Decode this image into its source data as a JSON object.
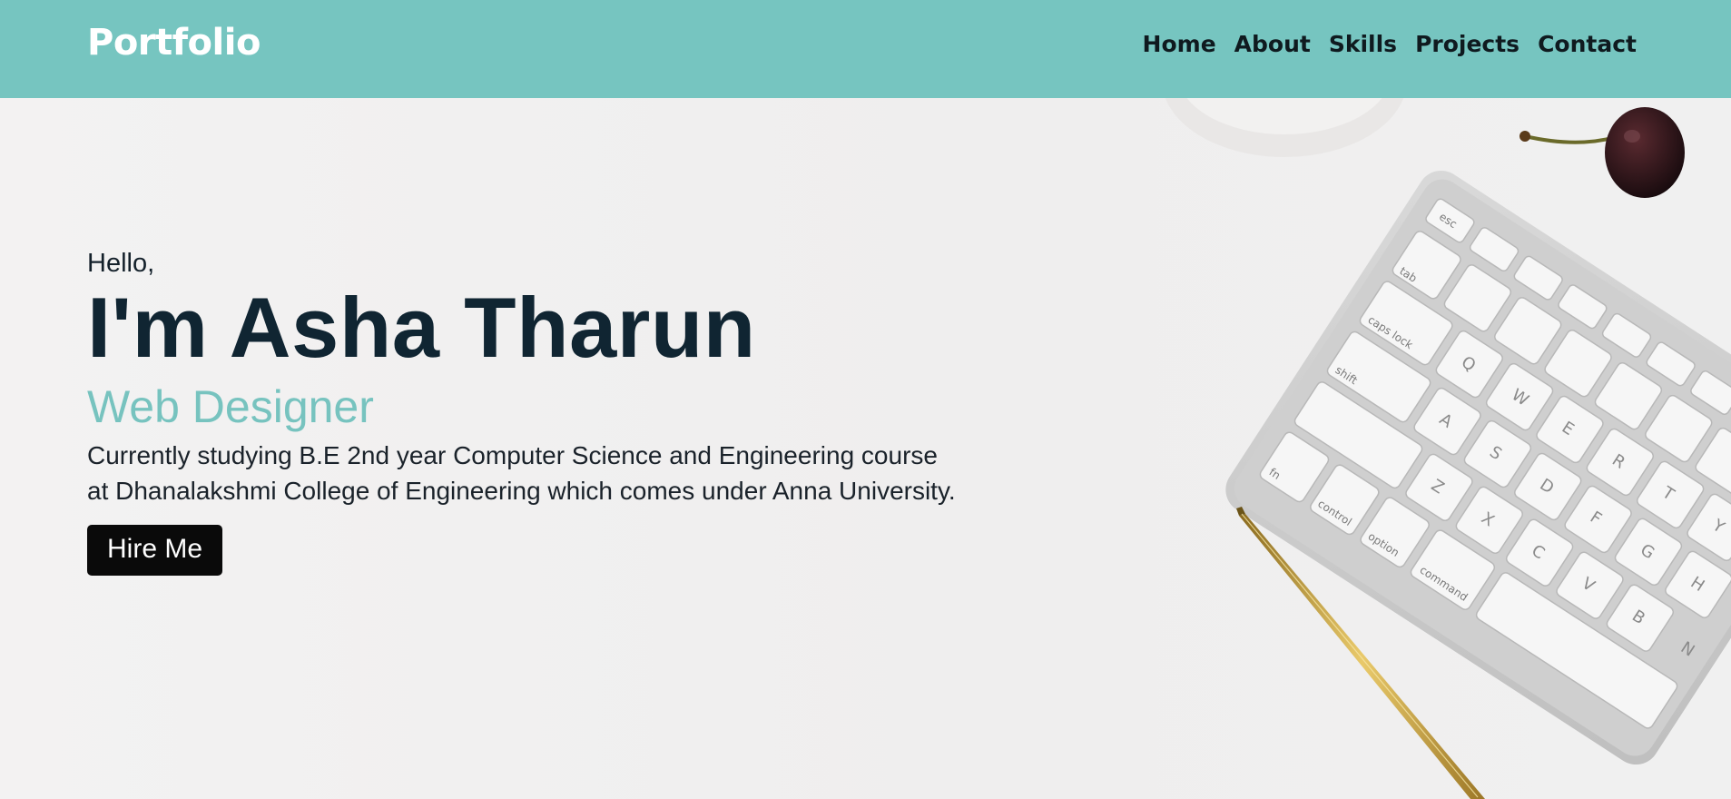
{
  "header": {
    "logo": "Portfolio",
    "nav": [
      {
        "label": "Home"
      },
      {
        "label": "About"
      },
      {
        "label": "Skills"
      },
      {
        "label": "Projects"
      },
      {
        "label": "Contact"
      }
    ]
  },
  "hero": {
    "greeting": "Hello,",
    "name": "I'm Asha Tharun",
    "role": "Web Designer",
    "description_line1": "Currently studying B.E 2nd year Computer Science and Engineering course",
    "description_line2": "at Dhanalakshmi College of Engineering which comes under Anna University.",
    "cta_label": "Hire Me"
  },
  "background": {
    "keys": [
      "esc",
      "tab",
      "caps lock",
      "shift",
      "fn",
      "control",
      "option",
      "command",
      "Q",
      "W",
      "E",
      "R",
      "T",
      "Y",
      "A",
      "S",
      "D",
      "F",
      "G",
      "H",
      "Z",
      "X",
      "C",
      "V",
      "B",
      "N"
    ]
  },
  "colors": {
    "header_bg": "#76c5c0",
    "accent": "#77c3bf",
    "button_bg": "#0a0a0a"
  }
}
